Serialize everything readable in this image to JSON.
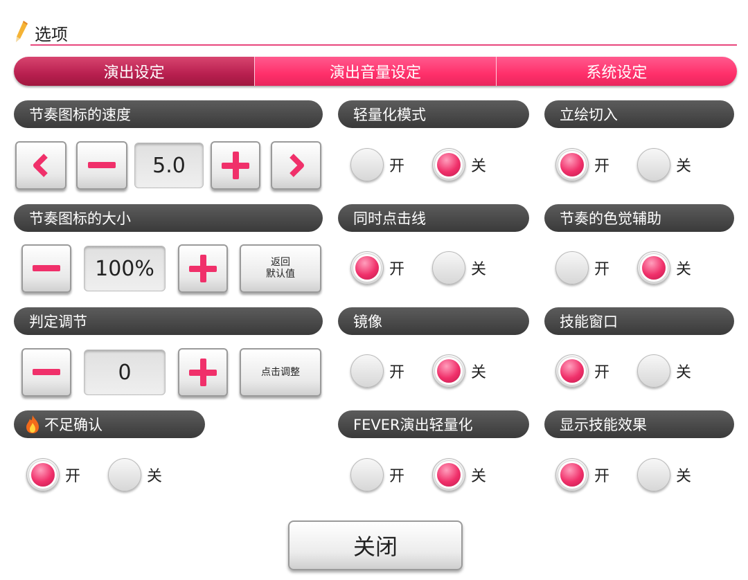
{
  "header": {
    "title": "选项",
    "accent": "#e8467c"
  },
  "tabs": [
    {
      "label": "演出设定",
      "active": true
    },
    {
      "label": "演出音量设定",
      "active": false
    },
    {
      "label": "系统设定",
      "active": false
    }
  ],
  "note_speed": {
    "title": "节奏图标的速度",
    "value": "5.0"
  },
  "note_size": {
    "title": "节奏图标的大小",
    "value": "100%",
    "reset_label_line1": "返回",
    "reset_label_line2": "默认值"
  },
  "timing": {
    "title": "判定调节",
    "value": "0",
    "adjust_label": "点击调整"
  },
  "shortage": {
    "title": "不足确认"
  },
  "toggles": {
    "on_label": "开",
    "off_label": "关",
    "lightweight_mode": {
      "title": "轻量化模式",
      "value": "off"
    },
    "portrait_cutin": {
      "title": "立绘切入",
      "value": "on"
    },
    "simultaneous_line": {
      "title": "同时点击线",
      "value": "on"
    },
    "color_assist": {
      "title": "节奏的色觉辅助",
      "value": "off"
    },
    "mirror": {
      "title": "镜像",
      "value": "off"
    },
    "skill_window": {
      "title": "技能窗口",
      "value": "on"
    },
    "shortage_confirm": {
      "value": "on"
    },
    "fever_lightweight": {
      "title": "FEVER演出轻量化",
      "value": "off"
    },
    "skill_effect": {
      "title": "显示技能效果",
      "value": "on"
    }
  },
  "close_label": "关闭",
  "colors": {
    "pink": "#ff2f6a",
    "dark_tab": "#b81f4f",
    "section_bg": "#444444"
  }
}
